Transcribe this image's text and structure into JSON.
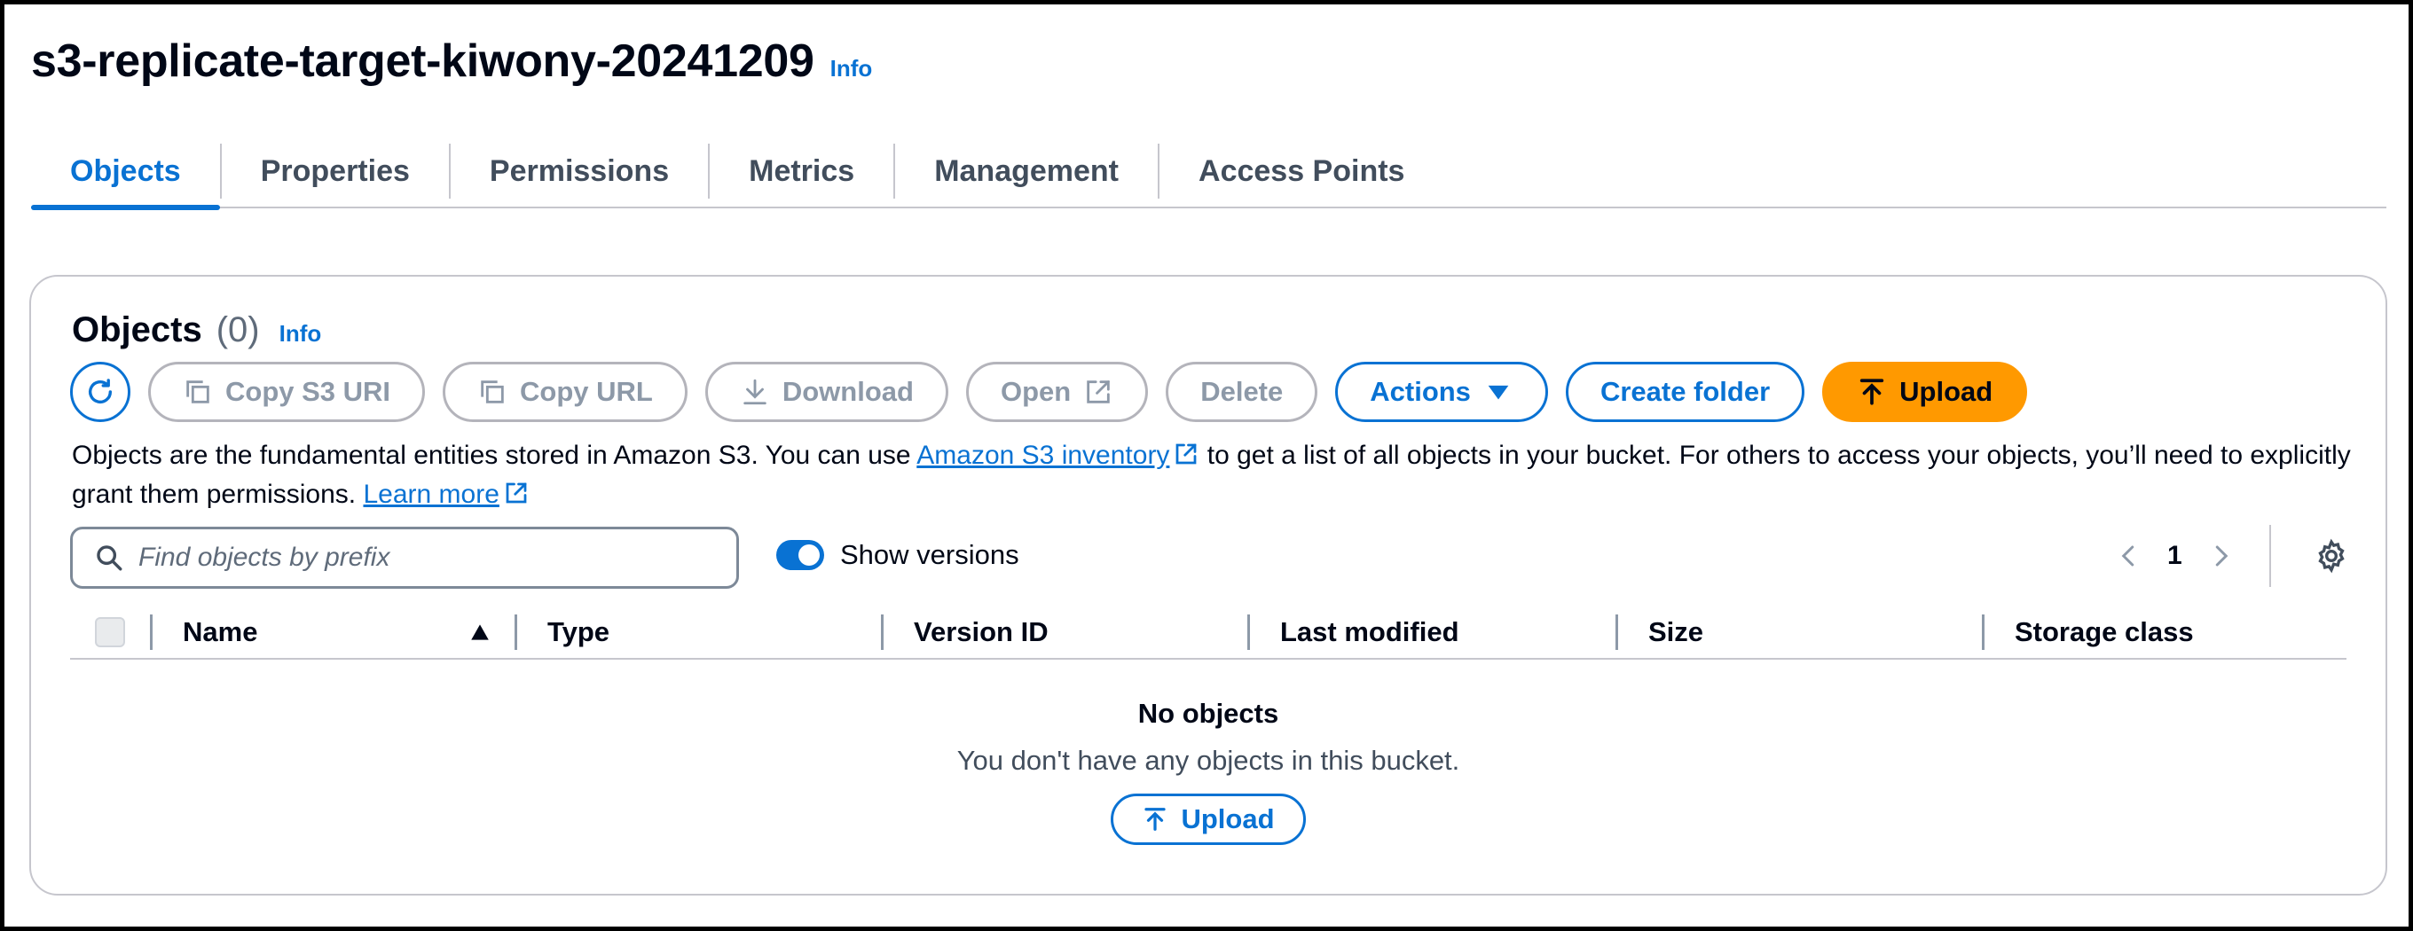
{
  "header": {
    "title": "s3-replicate-target-kiwony-20241209",
    "info": "Info"
  },
  "tabs": [
    {
      "label": "Objects",
      "active": true
    },
    {
      "label": "Properties"
    },
    {
      "label": "Permissions"
    },
    {
      "label": "Metrics"
    },
    {
      "label": "Management"
    },
    {
      "label": "Access Points"
    }
  ],
  "objects_panel": {
    "title": "Objects",
    "count": "(0)",
    "info": "Info",
    "toolbar": {
      "copy_s3_uri": "Copy S3 URI",
      "copy_url": "Copy URL",
      "download": "Download",
      "open": "Open",
      "delete": "Delete",
      "actions": "Actions",
      "create_folder": "Create folder",
      "upload": "Upload"
    },
    "description": {
      "part1": "Objects are the fundamental entities stored in Amazon S3. You can use ",
      "inventory_link": "Amazon S3 inventory",
      "part2": " to get a list of all objects in your bucket. For others to access your objects, you’ll need to explicitly grant them permissions. ",
      "learn_more": "Learn more"
    },
    "search": {
      "placeholder": "Find objects by prefix",
      "value": ""
    },
    "show_versions": {
      "label": "Show versions",
      "on": true
    },
    "pagination": {
      "current_page": "1"
    },
    "columns": [
      "Name",
      "Type",
      "Version ID",
      "Last modified",
      "Size",
      "Storage class"
    ],
    "empty": {
      "title": "No objects",
      "subtitle": "You don't have any objects in this bucket.",
      "upload": "Upload"
    }
  },
  "colors": {
    "link": "#0972d3",
    "primary_button": "#ff9900",
    "disabled": "#8d99a8",
    "text": "#000716"
  }
}
